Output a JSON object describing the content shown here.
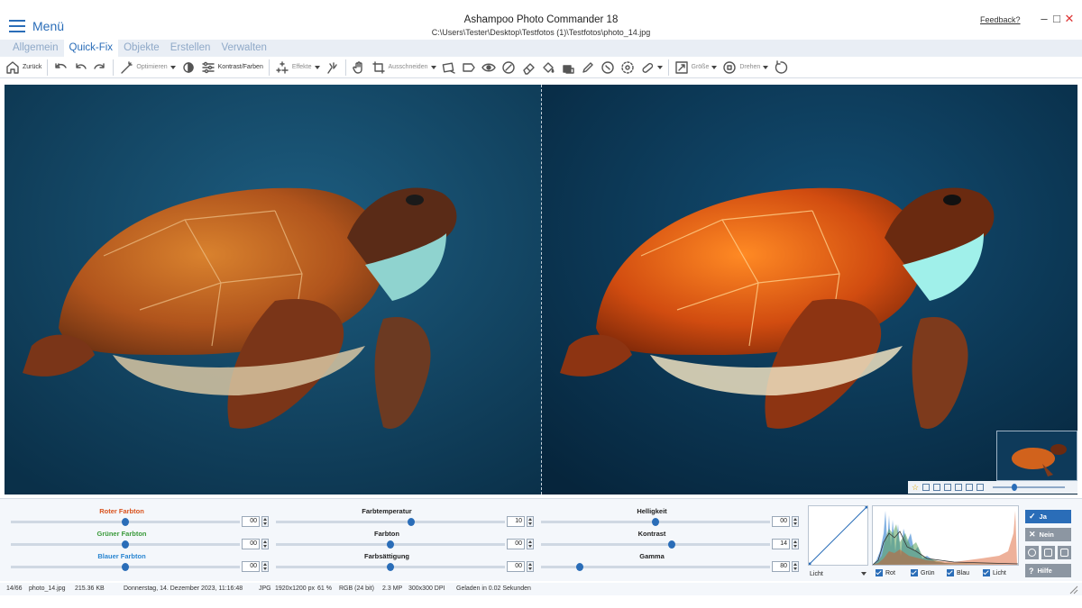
{
  "titlebar": {
    "menu_label": "Menü",
    "app_title": "Ashampoo Photo Commander 18",
    "file_path": "C:\\Users\\Tester\\Desktop\\Testfotos (1)\\Testfotos\\photo_14.jpg",
    "feedback_label": "Feedback?",
    "min_glyph": "–",
    "max_glyph": "□",
    "close_glyph": "✕"
  },
  "tabs": [
    {
      "label": "Allgemein",
      "active": false
    },
    {
      "label": "Quick-Fix",
      "active": true
    },
    {
      "label": "Objekte",
      "active": false
    },
    {
      "label": "Erstellen",
      "active": false
    },
    {
      "label": "Verwalten",
      "active": false
    }
  ],
  "toolbar": {
    "back_label": "Zurück",
    "optimize_label": "Optimieren",
    "contrast_label": "Kontrast/Farben",
    "effects_label": "Effekte",
    "crop_label": "Ausschneiden",
    "size_label": "Größe",
    "rotate_label": "Drehen",
    "icons": [
      "home-icon",
      "undo-all-icon",
      "undo-icon",
      "redo-icon",
      "magic-wand-icon",
      "brightness-icon",
      "sliders-icon",
      "sparkles-icon",
      "filter-icon",
      "hand-icon",
      "crop-icon",
      "straighten-icon",
      "frame-icon",
      "red-eye-icon",
      "bandage-icon",
      "eraser-icon",
      "fill-icon",
      "stamp-icon",
      "pen-icon",
      "smudge-icon",
      "blur-icon",
      "bandaid-icon",
      "resize-icon",
      "rotate-icon",
      "rotate-free-icon"
    ]
  },
  "viewer": {
    "bg_color": "#0c3554",
    "zoom_level": 0.3
  },
  "adjustments": {
    "red_hue": {
      "label": "Roter Farbton",
      "value": "00",
      "level": 0.5,
      "color": "#d9531e"
    },
    "green_hue": {
      "label": "Grüner Farbton",
      "value": "00",
      "level": 0.5,
      "color": "#3a9a3a"
    },
    "blue_hue": {
      "label": "Blauer Farbton",
      "value": "00",
      "level": 0.5,
      "color": "#2a86d1"
    },
    "temperature": {
      "label": "Farbtemperatur",
      "value": "10",
      "level": 0.59
    },
    "hue": {
      "label": "Farbton",
      "value": "00",
      "level": 0.5
    },
    "saturation": {
      "label": "Farbsättigung",
      "value": "00",
      "level": 0.5
    },
    "brightness": {
      "label": "Helligkeit",
      "value": "00",
      "level": 0.5
    },
    "contrast": {
      "label": "Kontrast",
      "value": "14",
      "level": 0.57
    },
    "gamma": {
      "label": "Gamma",
      "value": "80",
      "level": 0.17
    }
  },
  "curve": {
    "channel": "Licht"
  },
  "histogram": {
    "channels": [
      {
        "label": "Rot",
        "checked": true
      },
      {
        "label": "Grün",
        "checked": true
      },
      {
        "label": "Blau",
        "checked": true
      },
      {
        "label": "Licht",
        "checked": true
      }
    ]
  },
  "actions": {
    "ok_label": "Ja",
    "cancel_label": "Nein",
    "help_label": "Hilfe"
  },
  "status": {
    "index": "14/66",
    "filename": "photo_14.jpg",
    "filesize": "215.36 KB",
    "date": "Donnerstag, 14. Dezember 2023, 11:16:48",
    "format": "JPG",
    "dimensions": "1920x1200 px",
    "zoom": "61 %",
    "color_mode": "RGB (24 bit)",
    "megapixels": "2.3 MP",
    "dpi": "300x300 DPI",
    "load_time": "Geladen in 0.02 Sekunden"
  }
}
